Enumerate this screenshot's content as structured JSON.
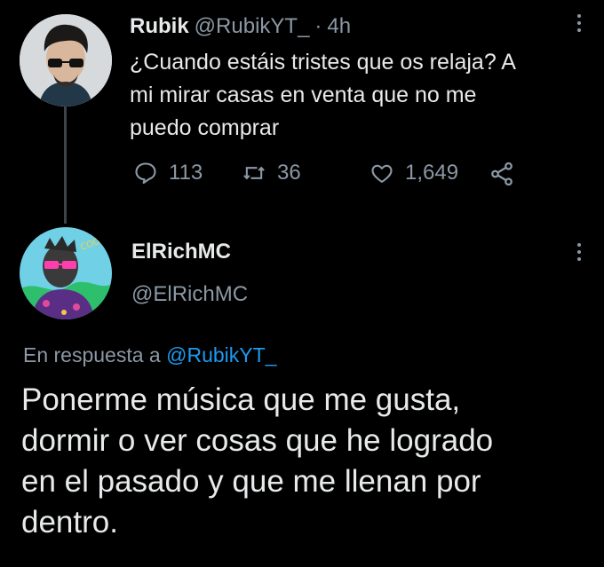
{
  "tweet1": {
    "display_name": "Rubik",
    "handle": "@RubikYT_",
    "separator": "·",
    "time": "4h",
    "text_lines": [
      "¿Cuando estáis tristes que os relaja? A",
      "mi mirar casas en venta que no me",
      "puedo comprar"
    ],
    "actions": {
      "replies": "113",
      "retweets": "36",
      "likes": "1,649"
    }
  },
  "tweet2": {
    "display_name": "ElRichMC",
    "handle": "@ElRichMC",
    "reply_prefix": "En respuesta a",
    "reply_to": "@RubikYT_",
    "text_lines": [
      "Ponerme música que me gusta,",
      "dormir o ver cosas que he logrado",
      "en el pasado y que me llenan por",
      "dentro."
    ]
  },
  "icons": {
    "more": "more-vertical-icon",
    "reply": "reply-icon",
    "retweet": "retweet-icon",
    "like": "heart-icon",
    "share": "share-icon"
  },
  "colors": {
    "background": "#000000",
    "text": "#e7e9ea",
    "muted": "#8b98a5",
    "link": "#1d9bf0"
  }
}
